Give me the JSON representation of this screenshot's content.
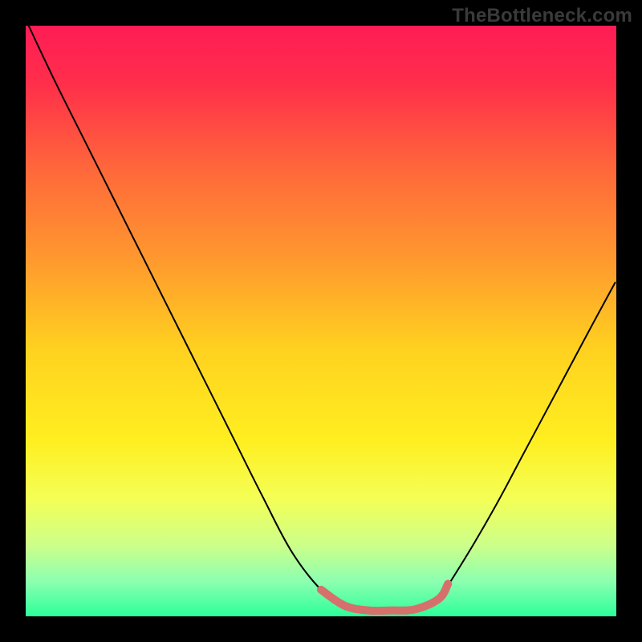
{
  "watermark": "TheBottleneck.com",
  "frame": {
    "bg_color": "#000000",
    "inner_size": 736,
    "margin": 32
  },
  "gradient": {
    "stops": [
      {
        "offset": 0.0,
        "color": "#ff1c55"
      },
      {
        "offset": 0.1,
        "color": "#ff2f4a"
      },
      {
        "offset": 0.25,
        "color": "#ff6a3a"
      },
      {
        "offset": 0.4,
        "color": "#ff9a2e"
      },
      {
        "offset": 0.55,
        "color": "#ffd21f"
      },
      {
        "offset": 0.7,
        "color": "#ffee20"
      },
      {
        "offset": 0.8,
        "color": "#f4ff55"
      },
      {
        "offset": 0.88,
        "color": "#ccff8a"
      },
      {
        "offset": 0.94,
        "color": "#8dffb0"
      },
      {
        "offset": 1.0,
        "color": "#2dff9a"
      }
    ]
  },
  "chart_data": {
    "type": "line",
    "title": "",
    "xlabel": "",
    "ylabel": "",
    "xlim": [
      0,
      1
    ],
    "ylim": [
      0,
      1
    ],
    "series": [
      {
        "name": "bottleneck-curve",
        "stroke": "#000000",
        "stroke_width": 2,
        "x": [
          0.005,
          0.05,
          0.1,
          0.15,
          0.2,
          0.25,
          0.3,
          0.35,
          0.4,
          0.45,
          0.5,
          0.54,
          0.58,
          0.62,
          0.66,
          0.7,
          0.72,
          0.76,
          0.8,
          0.84,
          0.88,
          0.92,
          0.96,
          0.998
        ],
        "y": [
          1.0,
          0.905,
          0.805,
          0.705,
          0.605,
          0.505,
          0.405,
          0.305,
          0.205,
          0.11,
          0.045,
          0.018,
          0.01,
          0.01,
          0.012,
          0.03,
          0.06,
          0.125,
          0.195,
          0.27,
          0.345,
          0.42,
          0.495,
          0.565
        ]
      },
      {
        "name": "optimal-band",
        "stroke": "#d6706c",
        "stroke_width": 10,
        "linecap": "round",
        "x": [
          0.5,
          0.54,
          0.58,
          0.62,
          0.66,
          0.7,
          0.715
        ],
        "y": [
          0.045,
          0.018,
          0.01,
          0.01,
          0.012,
          0.03,
          0.055
        ]
      }
    ]
  }
}
